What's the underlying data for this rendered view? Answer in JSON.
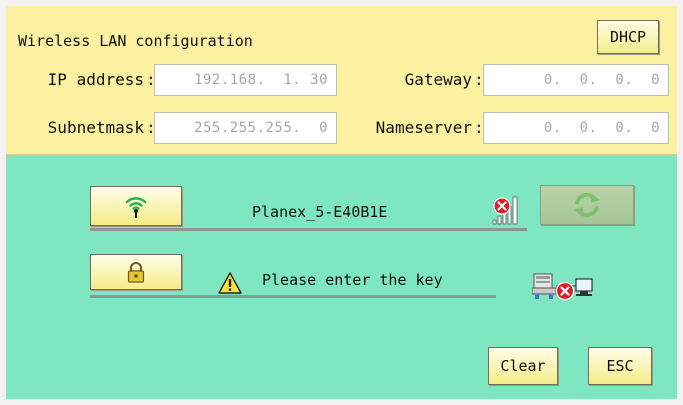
{
  "config": {
    "title": "Wireless LAN configuration",
    "dhcp_label": "DHCP",
    "ip_label": "IP address",
    "ip_value": "192.168.  1. 30",
    "gateway_label": "Gateway",
    "gateway_value": "0.  0.  0.  0",
    "subnet_label": "Subnetmask",
    "subnet_value": "255.255.255.  0",
    "nameserver_label": "Nameserver",
    "nameserver_value": "0.  0.  0.  0",
    "separator": ":"
  },
  "network": {
    "ssid": "Planex_5-E40B1E",
    "key_prompt": "Please enter the key"
  },
  "actions": {
    "clear_label": "Clear",
    "esc_label": "ESC"
  },
  "icons": {
    "wifi": "wifi-icon",
    "lock": "lock-icon",
    "warning": "warning-icon",
    "signal": "signal-error-icon",
    "refresh": "refresh-icon",
    "connection": "connection-error-icon"
  }
}
